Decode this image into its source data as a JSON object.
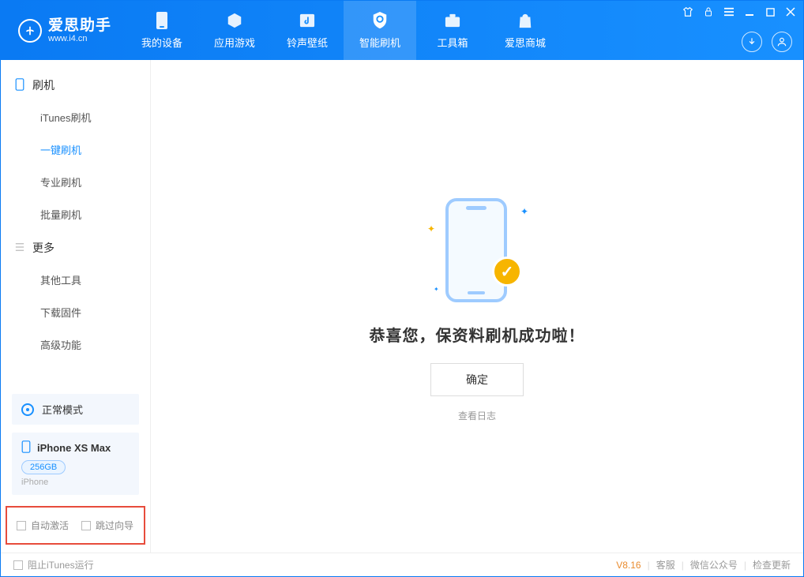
{
  "app": {
    "name_cn": "爱思助手",
    "name_en": "www.i4.cn"
  },
  "nav": {
    "device": "我的设备",
    "apps": "应用游戏",
    "ringtones": "铃声壁纸",
    "flash": "智能刷机",
    "toolbox": "工具箱",
    "store": "爱思商城"
  },
  "sidebar": {
    "group_flash": "刷机",
    "itunes_flash": "iTunes刷机",
    "one_click": "一键刷机",
    "pro_flash": "专业刷机",
    "batch_flash": "批量刷机",
    "group_more": "更多",
    "other_tools": "其他工具",
    "download_fw": "下载固件",
    "advanced": "高级功能",
    "mode_label": "正常模式",
    "device_name": "iPhone XS Max",
    "storage": "256GB",
    "device_type": "iPhone",
    "auto_activate": "自动激活",
    "skip_guide": "跳过向导"
  },
  "main": {
    "success": "恭喜您，保资料刷机成功啦！",
    "ok": "确定",
    "view_log": "查看日志"
  },
  "footer": {
    "block_itunes": "阻止iTunes运行",
    "version": "V8.16",
    "support": "客服",
    "wechat": "微信公众号",
    "check_update": "检查更新"
  }
}
